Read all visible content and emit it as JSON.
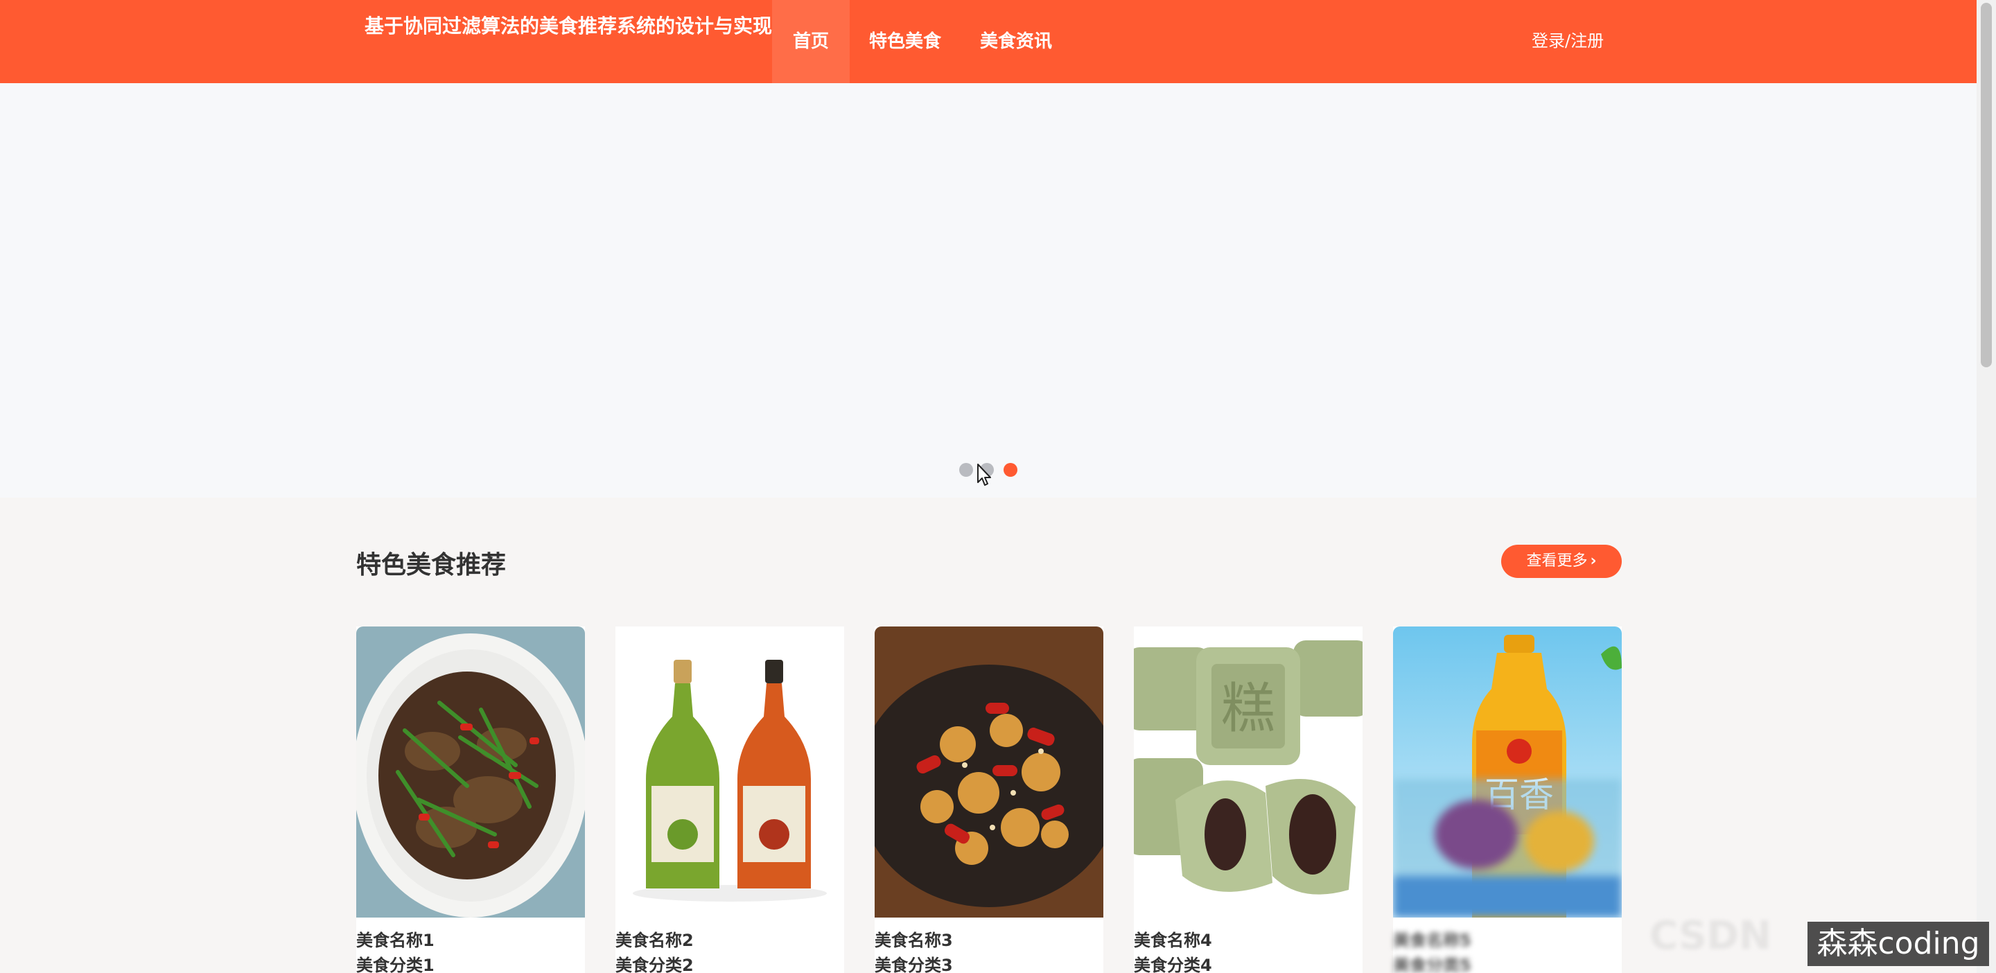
{
  "header": {
    "site_title": "基于协同过滤算法的美食推荐系统的设计与实现",
    "nav": [
      {
        "label": "首页"
      },
      {
        "label": "特色美食"
      },
      {
        "label": "美食资讯"
      }
    ],
    "login_label": "登录/注册",
    "brand_color": "#ff5a31"
  },
  "banner": {
    "dots_count": 3,
    "active_dot": 3
  },
  "featured": {
    "title": "特色美食推荐",
    "more_label": "查看更多",
    "more_icon": "chevron-right-icon",
    "items": [
      {
        "name": "美食名称1",
        "category": "美食分类1",
        "image": "stir-fried-beef-with-celery"
      },
      {
        "name": "美食名称2",
        "category": "美食分类2",
        "image": "organic-juice-bottles"
      },
      {
        "name": "美食名称3",
        "category": "美食分类3",
        "image": "kung-pao-chicken"
      },
      {
        "name": "美食名称4",
        "category": "美食分类4",
        "image": "green-bean-cakes"
      },
      {
        "name": "美食名称5",
        "category": "美食分类5",
        "image": "bottled-fruit-tea"
      }
    ]
  },
  "watermark": "森森coding"
}
